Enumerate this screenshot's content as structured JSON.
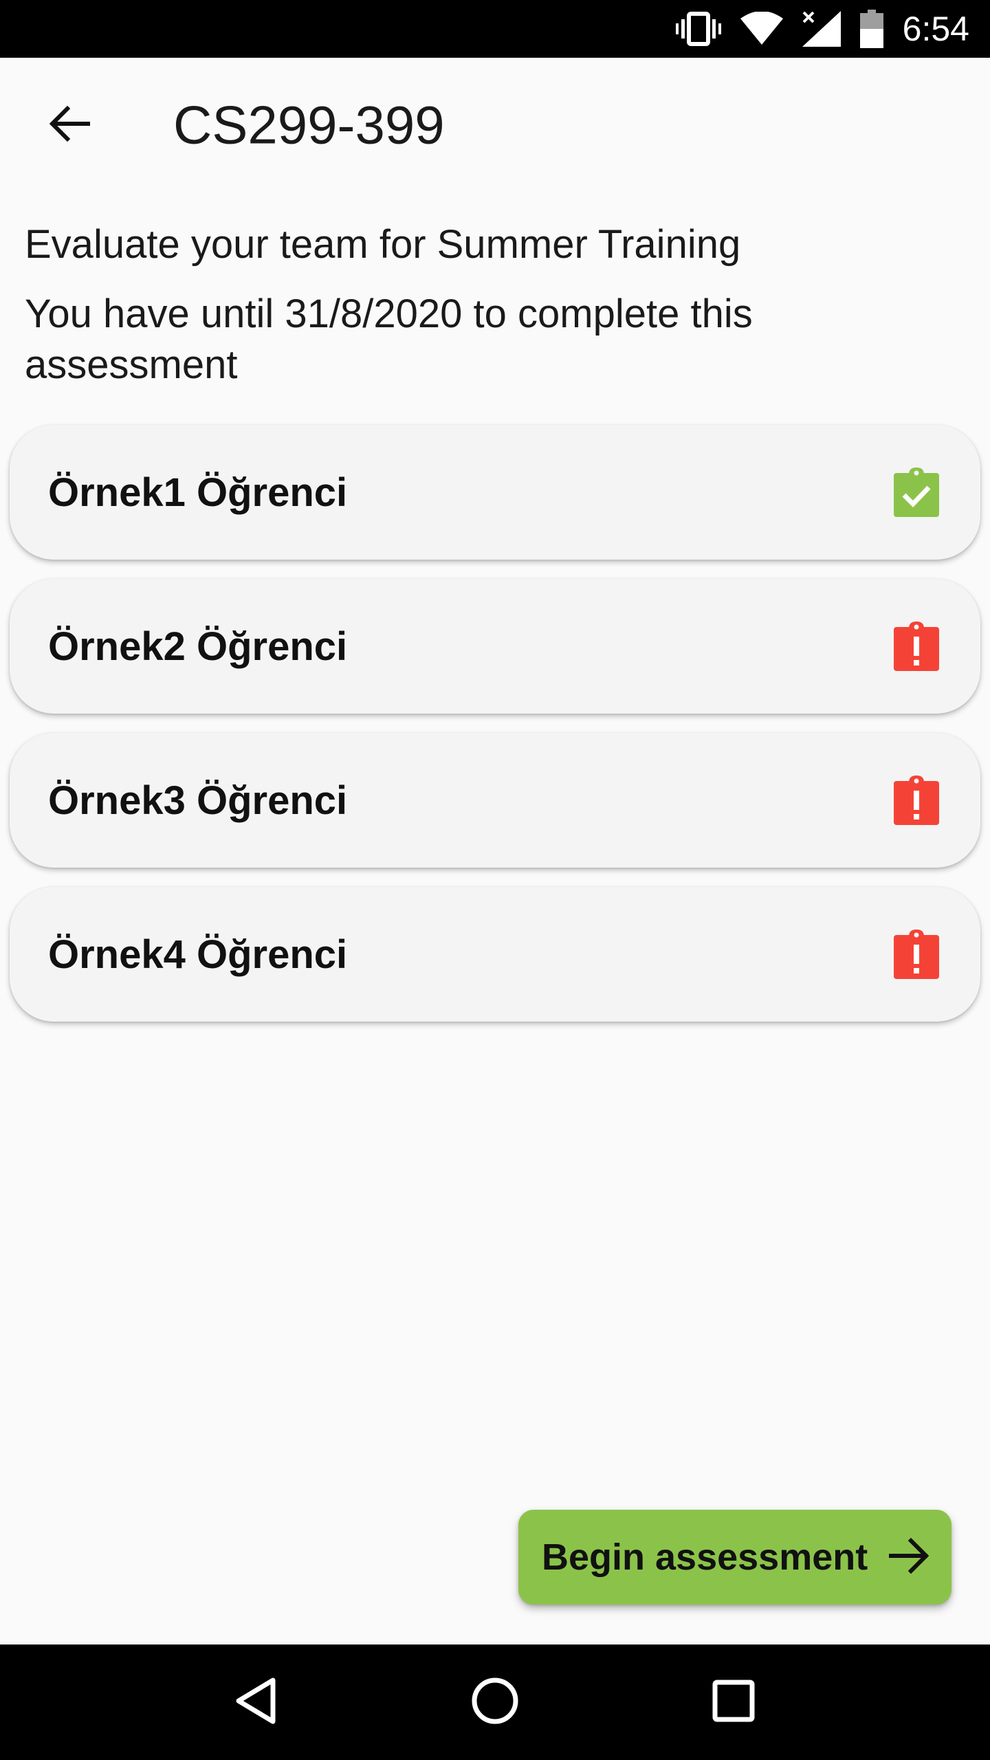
{
  "status_bar": {
    "time": "6:54",
    "icons": [
      "vibrate-icon",
      "wifi-icon",
      "signal-no-data-icon",
      "battery-icon"
    ]
  },
  "header": {
    "back_icon": "arrow-back-icon",
    "title": "CS299-399"
  },
  "intro": {
    "subtitle": "Evaluate your team for Summer Training",
    "deadline": "You have until 31/8/2020 to complete this assessment"
  },
  "team_members": [
    {
      "name": "Örnek1 Öğrenci",
      "status": "completed",
      "status_icon": "clipboard-check-icon",
      "color": "#8bc34a"
    },
    {
      "name": "Örnek2 Öğrenci",
      "status": "pending",
      "status_icon": "clipboard-alert-icon",
      "color": "#f44336"
    },
    {
      "name": "Örnek3 Öğrenci",
      "status": "pending",
      "status_icon": "clipboard-alert-icon",
      "color": "#f44336"
    },
    {
      "name": "Örnek4 Öğrenci",
      "status": "pending",
      "status_icon": "clipboard-alert-icon",
      "color": "#f44336"
    }
  ],
  "action": {
    "label": "Begin assessment",
    "icon": "arrow-forward-icon",
    "color": "#8bc34a"
  },
  "nav_bar": {
    "buttons": [
      "back-triangle-icon",
      "home-circle-icon",
      "recents-square-icon"
    ]
  }
}
